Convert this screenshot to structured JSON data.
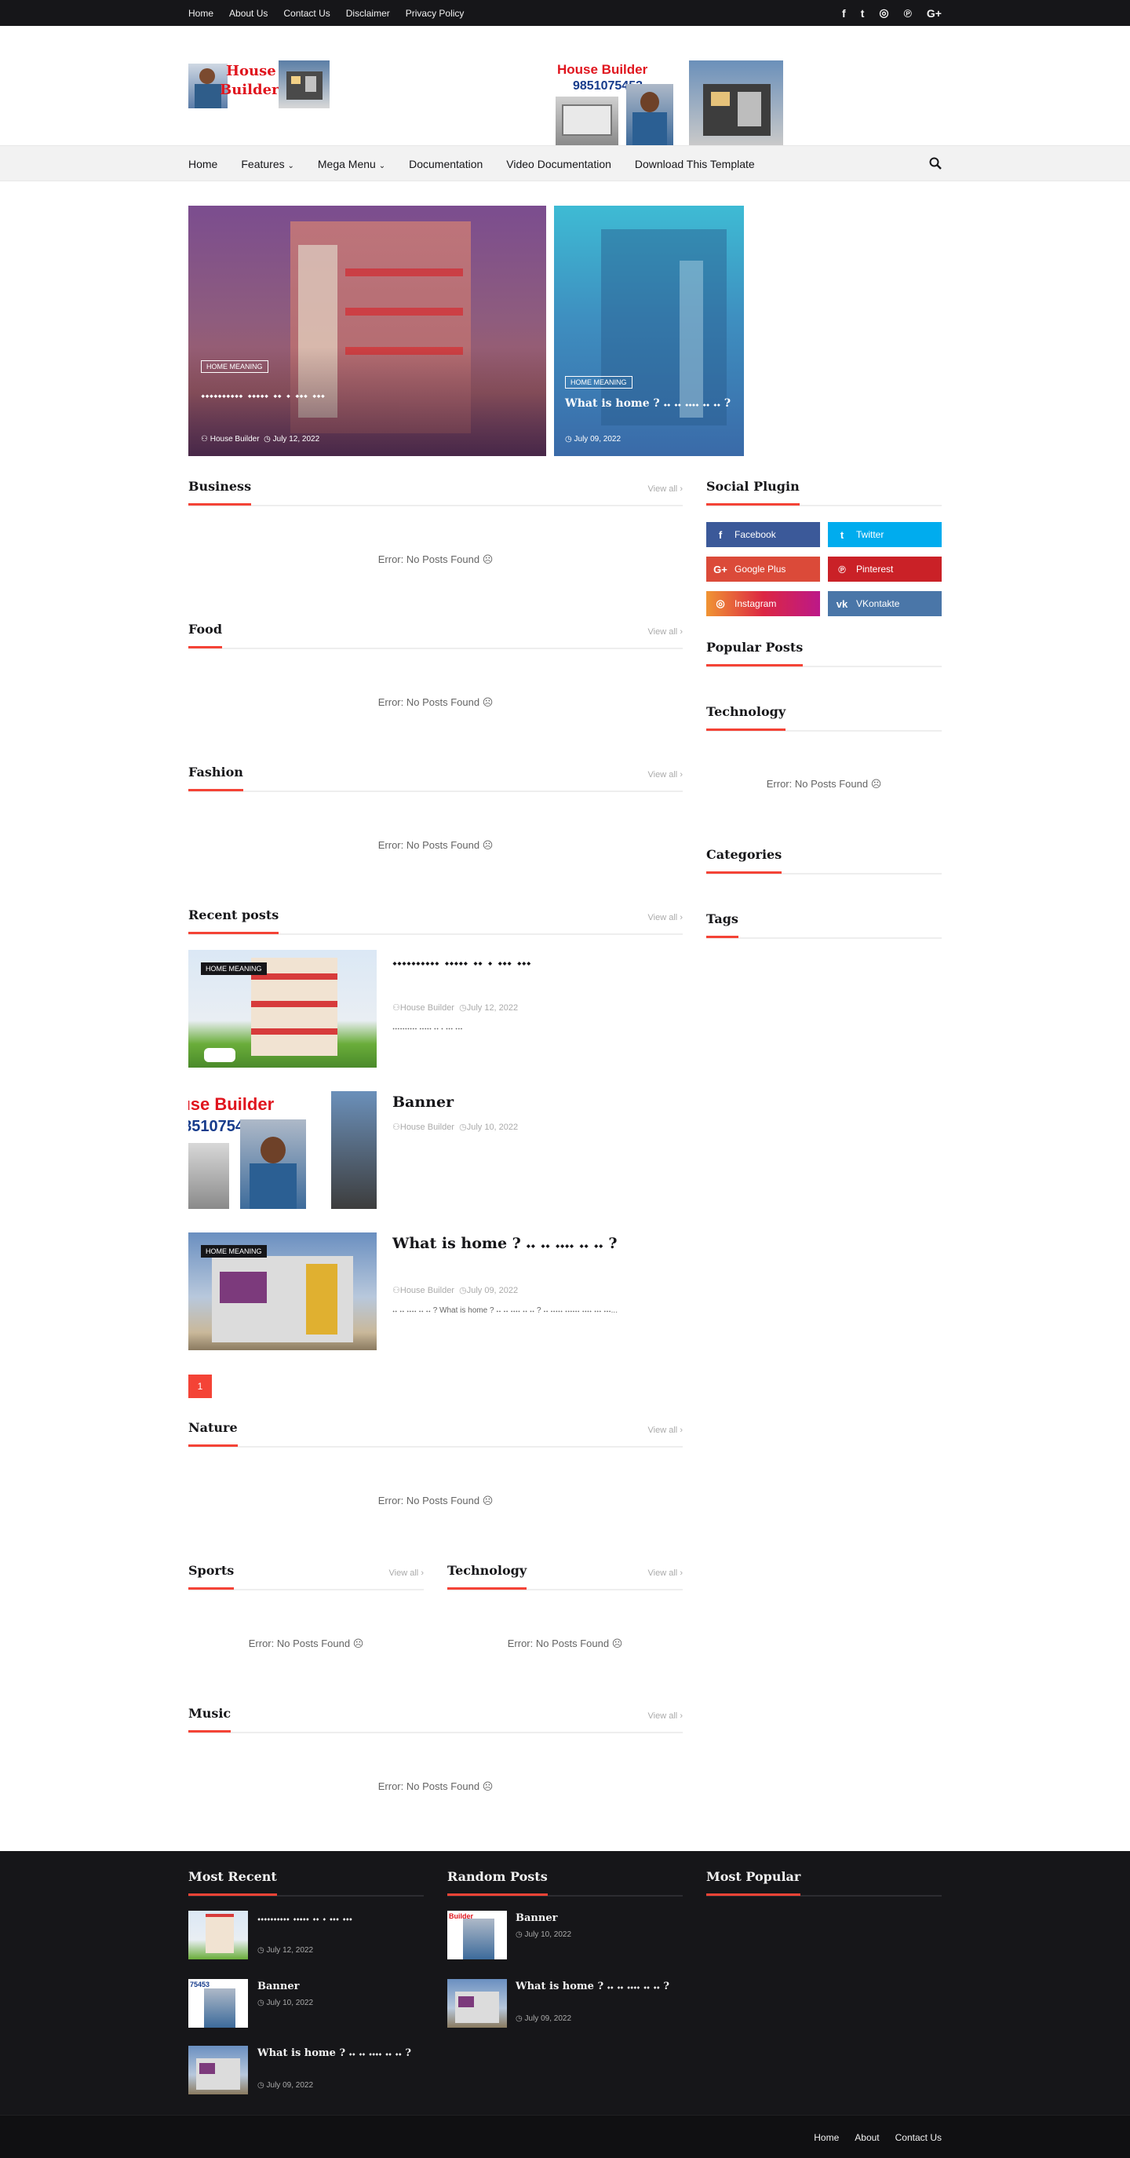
{
  "topbar": {
    "menu": [
      "Home",
      "About Us",
      "Contact Us",
      "Disclaimer",
      "Privacy Policy"
    ],
    "social_icons": [
      "facebook-icon",
      "twitter-icon",
      "instagram-icon",
      "pinterest-icon",
      "google-plus-icon"
    ],
    "social_glyphs": [
      "f",
      "t",
      "◎",
      "℗",
      "G+"
    ]
  },
  "header": {
    "logo_text": [
      "House",
      "Builder"
    ],
    "banner_title": "House Builder",
    "banner_phone": "9851075453"
  },
  "nav": {
    "items": [
      "Home",
      "Features",
      "Mega Menu",
      "Documentation",
      "Video Documentation",
      "Download This Template"
    ]
  },
  "featured": [
    {
      "label": "HOME MEANING",
      "title": "𝆺𝆺𝆺𝆺𝆺𝆺𝆺𝆺𝆺𝆺 𝆺𝆺𝆺𝆺𝆺 𝆺𝆺 𝆺 𝆺𝆺𝆺 𝆺𝆺𝆺",
      "author": "House Builder",
      "date": "July 12, 2022"
    },
    {
      "label": "HOME MEANING",
      "title": "What is home ? 𝆺𝆺 𝆺𝆺 𝆺𝆺𝆺𝆺 𝆺𝆺 𝆺𝆺 ?",
      "date": "July 09, 2022"
    }
  ],
  "sections": {
    "business": {
      "title": "Business",
      "view_all": "View all",
      "error": "Error: No Posts Found"
    },
    "food": {
      "title": "Food",
      "view_all": "View all",
      "error": "Error: No Posts Found"
    },
    "fashion": {
      "title": "Fashion",
      "view_all": "View all",
      "error": "Error: No Posts Found"
    },
    "recent": {
      "title": "Recent posts",
      "view_all": "View all"
    },
    "nature": {
      "title": "Nature",
      "view_all": "View all",
      "error": "Error: No Posts Found"
    },
    "sports": {
      "title": "Sports",
      "view_all": "View all",
      "error": "Error: No Posts Found"
    },
    "technology": {
      "title": "Technology",
      "view_all": "View all",
      "error": "Error: No Posts Found"
    },
    "music": {
      "title": "Music",
      "view_all": "View all",
      "error": "Error: No Posts Found"
    }
  },
  "recent_posts": [
    {
      "label": "HOME MEANING",
      "title": "𝆺𝆺𝆺𝆺𝆺𝆺𝆺𝆺𝆺𝆺 𝆺𝆺𝆺𝆺𝆺 𝆺𝆺 𝆺 𝆺𝆺𝆺 𝆺𝆺𝆺",
      "author": "House Builder",
      "date": "July 12, 2022",
      "snippet": "𝆺𝆺𝆺𝆺𝆺𝆺𝆺𝆺𝆺𝆺 𝆺𝆺𝆺𝆺𝆺 𝆺𝆺 𝆺 𝆺𝆺𝆺 𝆺𝆺𝆺"
    },
    {
      "title": "Banner",
      "author": "House Builder",
      "date": "July 10, 2022"
    },
    {
      "label": "HOME MEANING",
      "title": "What is home ? 𝆺𝆺 𝆺𝆺 𝆺𝆺𝆺𝆺 𝆺𝆺 𝆺𝆺 ?",
      "author": "House Builder",
      "date": "July 09, 2022",
      "snippet": "𝆺𝆺 𝆺𝆺 𝆺𝆺𝆺𝆺 𝆺𝆺 𝆺𝆺 ? What is home ? 𝆺𝆺 𝆺𝆺 𝆺𝆺𝆺𝆺 𝆺𝆺 𝆺𝆺 ? 𝆺𝆺 𝆺𝆺𝆺𝆺𝆺 𝆺𝆺𝆺𝆺𝆺𝆺 𝆺𝆺𝆺𝆺 𝆺𝆺𝆺 𝆺𝆺𝆺..."
    }
  ],
  "pagination": {
    "current": "1"
  },
  "sidebar": {
    "social_plugin": {
      "title": "Social Plugin",
      "buttons": [
        {
          "label": "Facebook",
          "glyph": "f",
          "color": "#3b5999"
        },
        {
          "label": "Twitter",
          "glyph": "t",
          "color": "#00acee"
        },
        {
          "label": "Google Plus",
          "glyph": "G+",
          "color": "#db4a39"
        },
        {
          "label": "Pinterest",
          "glyph": "℗",
          "color": "#ca2127"
        },
        {
          "label": "Instagram",
          "glyph": "◎",
          "color": "#c13584"
        },
        {
          "label": "VKontakte",
          "glyph": "vk",
          "color": "#4a76a8"
        }
      ]
    },
    "popular_posts": {
      "title": "Popular Posts"
    },
    "technology": {
      "title": "Technology",
      "error": "Error: No Posts Found"
    },
    "categories": {
      "title": "Categories"
    },
    "tags": {
      "title": "Tags"
    }
  },
  "footer": {
    "most_recent": {
      "title": "Most Recent",
      "items": [
        {
          "title": "𝆺𝆺𝆺𝆺𝆺𝆺𝆺𝆺𝆺𝆺 𝆺𝆺𝆺𝆺𝆺 𝆺𝆺 𝆺 𝆺𝆺𝆺 𝆺𝆺𝆺",
          "date": "July 12, 2022"
        },
        {
          "title": "Banner",
          "date": "July 10, 2022"
        },
        {
          "title": "What is home ? 𝆺𝆺 𝆺𝆺 𝆺𝆺𝆺𝆺 𝆺𝆺 𝆺𝆺 ?",
          "date": "July 09, 2022"
        }
      ]
    },
    "random_posts": {
      "title": "Random Posts",
      "items": [
        {
          "title": "Banner",
          "date": "July 10, 2022"
        },
        {
          "title": "What is home ? 𝆺𝆺 𝆺𝆺 𝆺𝆺𝆺𝆺 𝆺𝆺 𝆺𝆺 ?",
          "date": "July 09, 2022"
        }
      ]
    },
    "most_popular": {
      "title": "Most Popular"
    },
    "menu": [
      "Home",
      "About",
      "Contact Us"
    ]
  },
  "colors": {
    "accent": "#f44336",
    "dark": "#161619"
  }
}
